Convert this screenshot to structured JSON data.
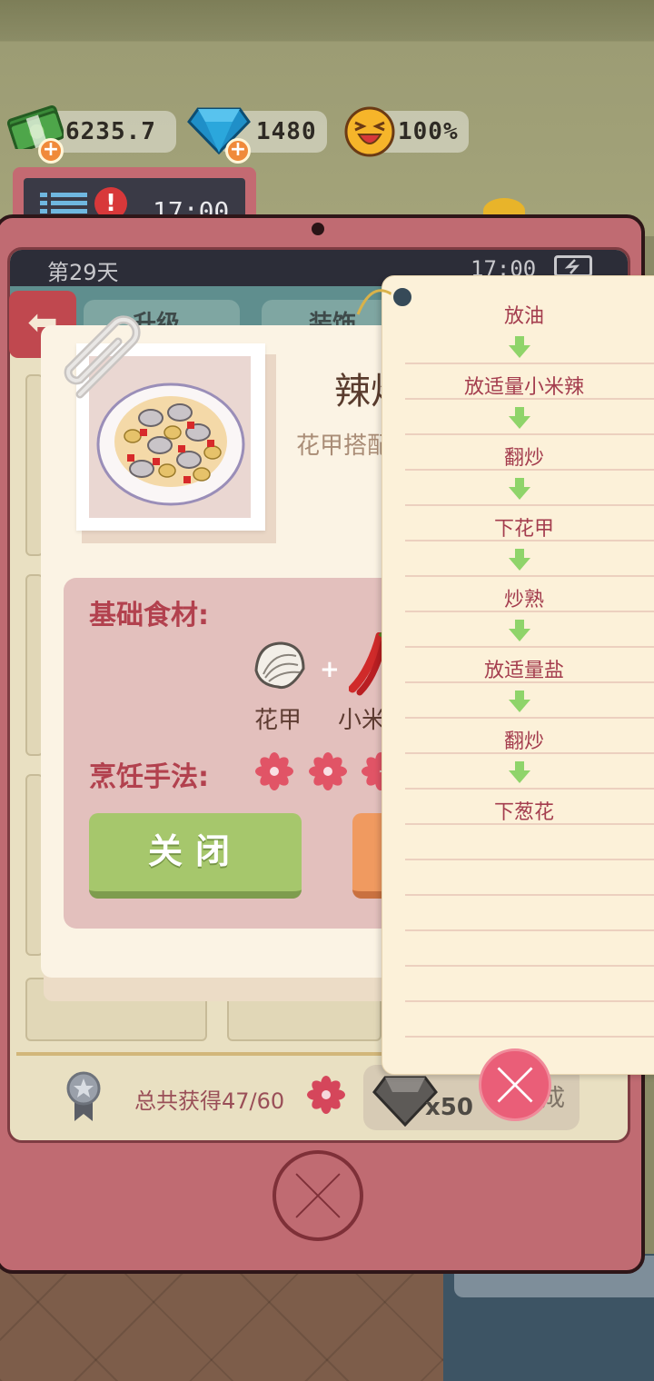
{
  "hud": {
    "cash": "6235.7",
    "gems": "1480",
    "satisfaction": "100%"
  },
  "tablet": {
    "day": "第29天",
    "time": "17:00",
    "tabs": [
      "升级",
      "装饰"
    ],
    "total_label": "总共获得47/60",
    "reward_count": "x50",
    "reward_label": "成"
  },
  "top_device": {
    "time": "17:00"
  },
  "recipe": {
    "title": "辣炒",
    "description": "花甲搭配",
    "ingredients_label": "基础食材:",
    "ingredients": [
      {
        "name": "花甲",
        "icon": "clam-icon"
      },
      {
        "name": "小米",
        "icon": "chili-icon"
      }
    ],
    "cooking_label": "烹饪手法:",
    "rating_icons": [
      "flower-icon",
      "flower-icon",
      "flower-icon"
    ],
    "close_button": "关闭"
  },
  "steps": [
    "放油",
    "放适量小米辣",
    "翻炒",
    "下花甲",
    "炒熟",
    "放适量盐",
    "翻炒",
    "下葱花"
  ],
  "colors": {
    "tablet_frame": "#c06b72",
    "accent_red": "#b2414e",
    "close_button": "#a6c76c",
    "step_arrow": "#8fd46a",
    "close_x": "#ea5e78"
  }
}
